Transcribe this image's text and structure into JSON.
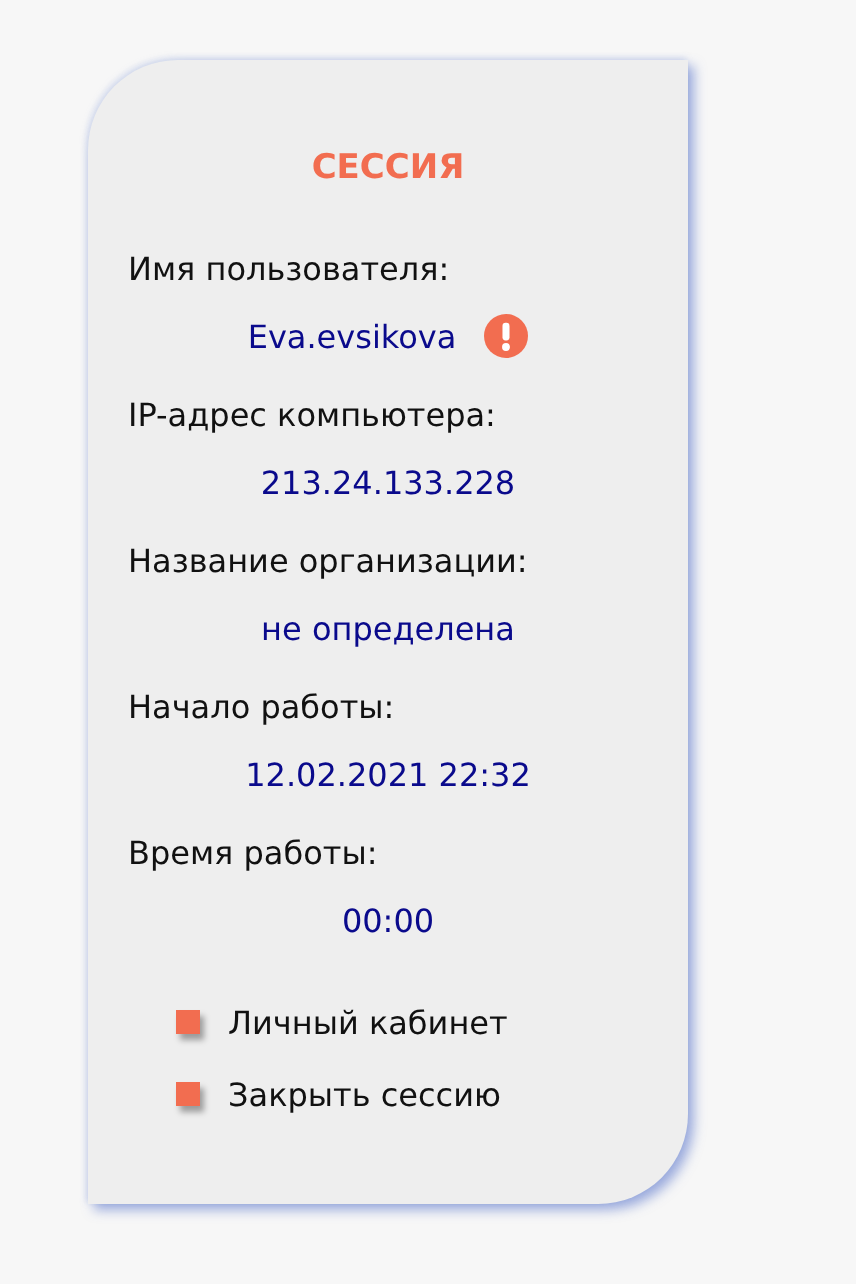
{
  "session": {
    "title": "СЕССИЯ",
    "fields": [
      {
        "label": "Имя пользователя:",
        "value": "Eva.evsikova",
        "warning": true
      },
      {
        "label": "IP-адрес компьютера:",
        "value": "213.24.133.228"
      },
      {
        "label": "Название организации:",
        "value": "не определена"
      },
      {
        "label": "Начало работы:",
        "value": "12.02.2021 22:32"
      },
      {
        "label": "Время работы:",
        "value": "00:00"
      }
    ],
    "links": [
      {
        "label": "Личный кабинет"
      },
      {
        "label": "Закрыть сессию"
      }
    ]
  }
}
